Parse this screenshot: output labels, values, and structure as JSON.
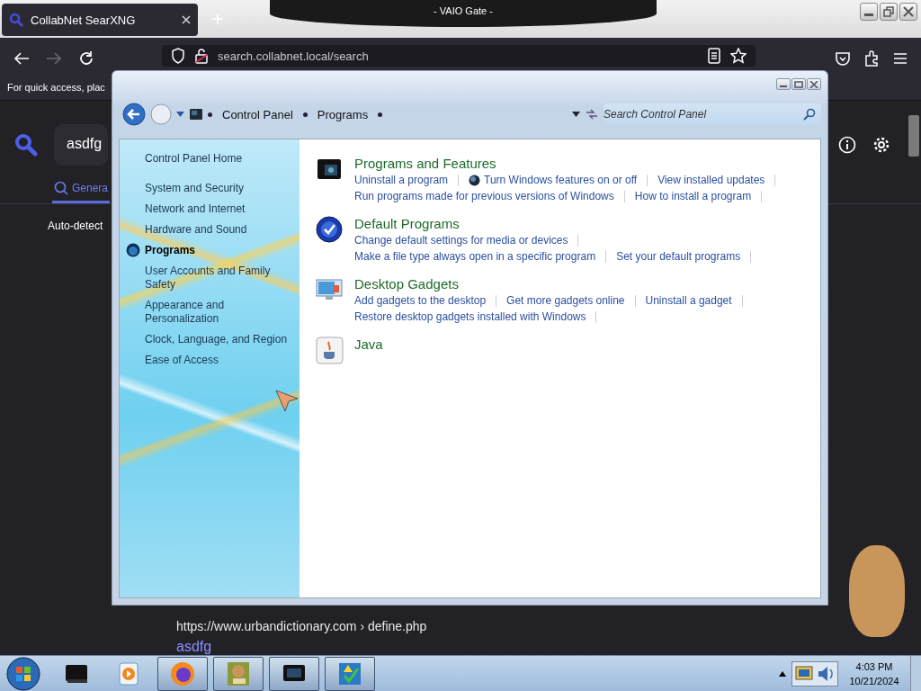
{
  "browser": {
    "window_title": "- VAIO Gate -",
    "tab": {
      "title": "CollabNet SearXNG"
    },
    "address": "search.collabnet.local/search",
    "bookmarks_hint": "For quick access, plac",
    "search": {
      "value": "asdfg"
    },
    "category_tab": {
      "label": "Genera",
      "selected": true
    },
    "language": "Auto-detect",
    "result": {
      "url": "https://www.urbandictionary.com",
      "path": "› define.php",
      "title": "asdfg"
    }
  },
  "control_panel": {
    "breadcrumb": [
      "Control Panel",
      "Programs"
    ],
    "search": {
      "placeholder": "Search Control Panel"
    },
    "sidebar": [
      {
        "label": "Control Panel Home",
        "selected": false
      },
      {
        "label": "System and Security",
        "selected": false
      },
      {
        "label": "Network and Internet",
        "selected": false
      },
      {
        "label": "Hardware and Sound",
        "selected": false
      },
      {
        "label": "Programs",
        "selected": true
      },
      {
        "label": "User Accounts and Family Safety",
        "selected": false
      },
      {
        "label": "Appearance and Personalization",
        "selected": false
      },
      {
        "label": "Clock, Language, and Region",
        "selected": false
      },
      {
        "label": "Ease of Access",
        "selected": false
      }
    ],
    "sections": [
      {
        "kind": "programs",
        "title": "Programs and Features",
        "links": [
          {
            "text": "Uninstall a program"
          },
          {
            "text": "Turn Windows features on or off",
            "kind": "shield"
          },
          {
            "text": "View installed updates"
          },
          {
            "text": "Run programs made for previous versions of Windows"
          },
          {
            "text": "How to install a program"
          }
        ]
      },
      {
        "kind": "defaults",
        "title": "Default Programs",
        "links": [
          {
            "text": "Change default settings for media or devices"
          },
          {
            "text": "Make a file type always open in a specific program"
          },
          {
            "text": "Set your default programs"
          }
        ]
      },
      {
        "kind": "gadgets",
        "title": "Desktop Gadgets",
        "links": [
          {
            "text": "Add gadgets to the desktop"
          },
          {
            "text": "Get more gadgets online"
          },
          {
            "text": "Uninstall a gadget"
          },
          {
            "text": "Restore desktop gadgets installed with Windows"
          }
        ]
      },
      {
        "kind": "java",
        "title": "Java"
      }
    ]
  },
  "taskbar": {
    "clock": {
      "time": "4:03 PM",
      "date": "10/21/2024"
    }
  }
}
